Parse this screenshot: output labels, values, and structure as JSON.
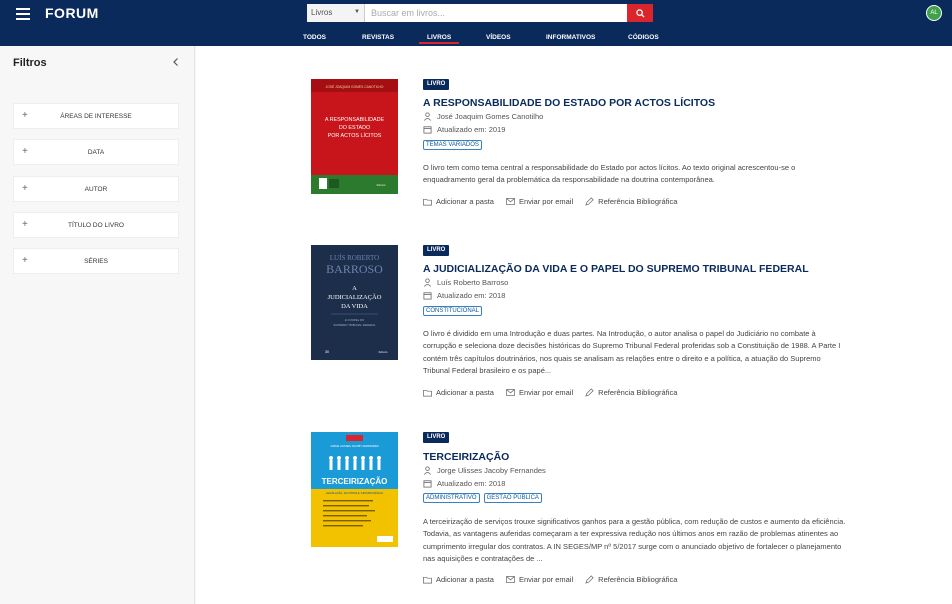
{
  "header": {
    "logo": "FORUM",
    "search": {
      "scope": "Livros",
      "placeholder": "Buscar em livros..."
    },
    "avatar": "AL",
    "nav": [
      "TODOS",
      "REVISTAS",
      "LIVROS",
      "VÍDEOS",
      "INFORMATIVOS",
      "CÓDIGOS"
    ],
    "active_nav": "LIVROS"
  },
  "sidebar": {
    "title": "Filtros",
    "filters": [
      "ÁREAS DE INTERESSE",
      "DATA",
      "AUTOR",
      "TÍTULO DO LIVRO",
      "SÉRIES"
    ]
  },
  "actions": {
    "add_folder": "Adicionar a pasta",
    "email": "Enviar por email",
    "reference": "Referência Bibliográfica"
  },
  "books": [
    {
      "badge": "LIVRO",
      "title": "A RESPONSABILIDADE DO ESTADO POR ACTOS LÍCITOS",
      "author": "José Joaquim Gomes Canotilho",
      "updated": "Atualizado em: 2019",
      "tags": [
        "TEMAS VARIADOS"
      ],
      "description": "O livro tem como tema central a responsabilidade do Estado por actos lícitos. Ao texto original acrescentou-se o enquadramento geral da problemática da responsabilidade na doutrina contemporânea.",
      "cover": {
        "bg": "#c8151b",
        "band": "#2b7a2e",
        "top_text": "JOSÉ JOAQUIM GOMES CANOTILHO",
        "text": "A RESPONSABILIDADE DO ESTADO POR ACTOS LÍCITOS"
      }
    },
    {
      "badge": "LIVRO",
      "title": "A JUDICIALIZAÇÃO DA VIDA E O PAPEL DO SUPREMO TRIBUNAL FEDERAL",
      "author": "Luís Roberto Barroso",
      "updated": "Atualizado em: 2018",
      "tags": [
        "CONSTITUCIONAL"
      ],
      "description": "O livro é dividido em uma Introdução e duas partes. Na Introdução, o autor analisa o papel do Judiciário no combate à corrupção e seleciona doze decisões históricas do Supremo Tribunal Federal proferidas sob a Constituição de 1988. A Parte I contém três capítulos doutrinários, nos quais se analisam as relações entre o direito e a política, a atuação do Supremo Tribunal Federal brasileiro e os papé...",
      "cover": {
        "bg": "#1c2e4a",
        "author": "LUÍS ROBERTO BARROSO",
        "text": "A JUDICIALIZAÇÃO DA VIDA",
        "sub": "E O PAPEL DO SUPREMO TRIBUNAL FEDERAL"
      }
    },
    {
      "badge": "LIVRO",
      "title": "TERCEIRIZAÇÃO",
      "author": "Jorge Ulisses Jacoby Fernandes",
      "updated": "Atualizado em: 2018",
      "tags": [
        "ADMINISTRATIVO",
        "GESTÃO PÚBLICA"
      ],
      "description": "A terceirização de serviços trouxe significativos ganhos para a gestão pública, com redução de custos e aumento da eficiência. Todavia, as vantagens auferidas começaram a ter expressiva redução nos últimos anos em razão de problemas atinentes ao cumprimento irregular dos contratos. A IN SEGES/MP nº 5/2017 surge com o anunciado objetivo de fortalecer o planejamento nas aquisições e contratações de ...",
      "cover": {
        "bg": "#1a9ad6",
        "band": "#f2c200",
        "text": "TERCEIRIZAÇÃO",
        "sub": "LEGISLAÇÃO, DOUTRINA E JURISPRUDÊNCIA"
      }
    }
  ]
}
